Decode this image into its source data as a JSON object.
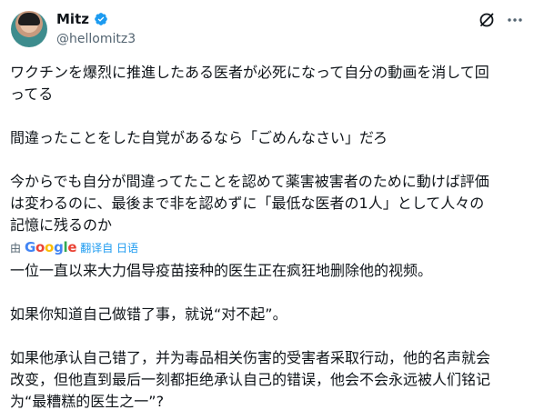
{
  "author": {
    "name": "Mitz",
    "handle": "@hellomitz3"
  },
  "icons": {
    "avatar": "avatar-photo",
    "verified": "verified-badge-icon",
    "action": "grok-slash-icon",
    "more": "more-horizontal-icon"
  },
  "colors": {
    "verified": "#1d9bf0",
    "link": "#1d9bf0",
    "muted": "#536471",
    "text": "#0f1419"
  },
  "post": {
    "jp_lines": [
      "ワクチンを爆烈に推進したある医者が必死になって自分の動画を消して回",
      "ってる",
      "",
      "間違ったことをした自覚があるなら「ごめんなさい」だろ",
      "",
      "今からでも自分が間違ってたことを認めて薬害被害者のために動けば評価",
      "は変わるのに、最後まで非を認めずに「最低な医者の1人」として人々の",
      "記憶に残るのか"
    ],
    "translation_by": "由",
    "translation_engine": "Google",
    "translation_link": "翻译自 日语",
    "zh_lines": [
      "一位一直以来大力倡导疫苗接种的医生正在疯狂地删除他的视频。",
      "",
      "如果你知道自己做错了事，就说“对不起”。",
      "",
      "如果他承认自己错了，并为毒品相关伤害的受害者采取行动，他的名声就会",
      "改变，但他直到最后一刻都拒绝承认自己的错误，他会不会永远被人们铭记",
      "为“最糟糕的医生之一”?"
    ]
  }
}
